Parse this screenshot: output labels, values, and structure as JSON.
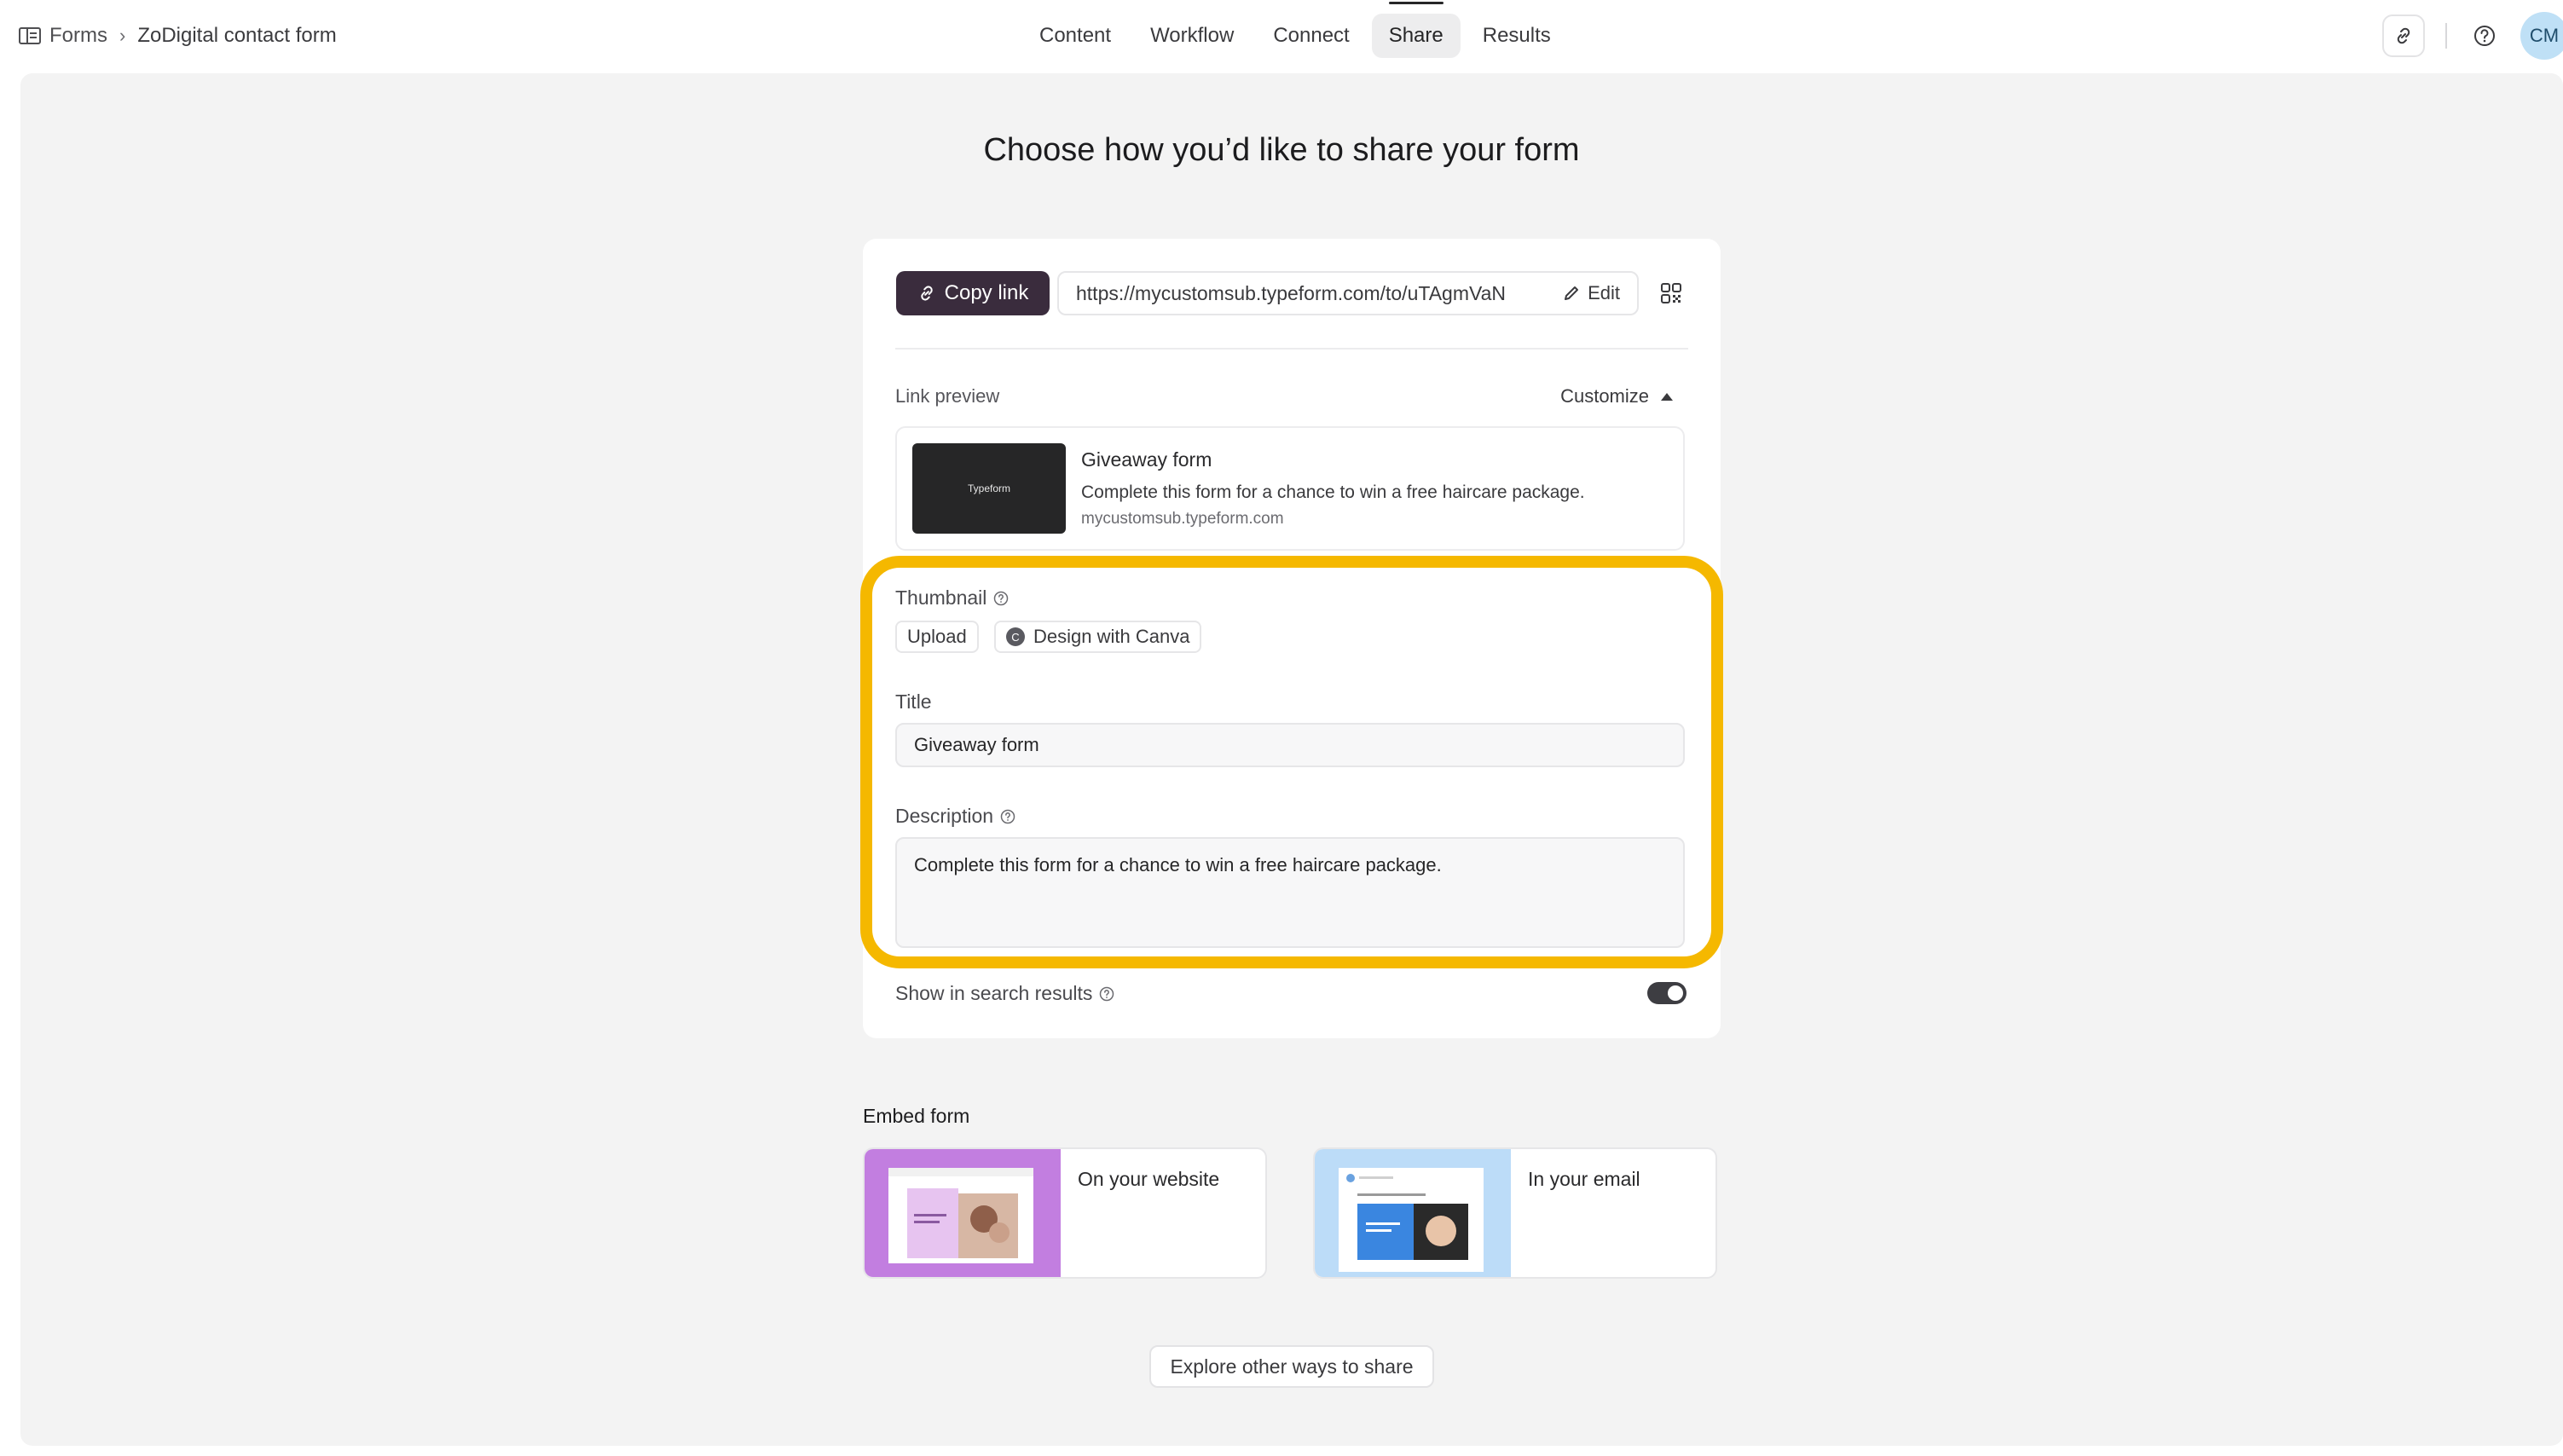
{
  "breadcrumb": {
    "root": "Forms",
    "current": "ZoDigital contact form"
  },
  "nav": {
    "tabs": [
      {
        "label": "Content"
      },
      {
        "label": "Workflow"
      },
      {
        "label": "Connect"
      },
      {
        "label": "Share",
        "active": true
      },
      {
        "label": "Results"
      }
    ]
  },
  "user": {
    "initials": "CM"
  },
  "page": {
    "heading": "Choose how you’d like to share your form"
  },
  "share": {
    "copy_label": "Copy link",
    "url": "https://mycustomsub.typeform.com/to/uTAgmVaN",
    "edit_label": "Edit",
    "link_preview_label": "Link preview",
    "customize_label": "Customize",
    "preview": {
      "thumb_text": "Typeform",
      "title": "Giveaway form",
      "description": "Complete this form for a chance to win a free haircare package.",
      "domain": "mycustomsub.typeform.com"
    },
    "thumbnail_label": "Thumbnail",
    "upload_label": "Upload",
    "canva_label": "Design with Canva",
    "title_label": "Title",
    "title_value": "Giveaway form",
    "description_label": "Description",
    "description_value": "Complete this form for a chance to win a free haircare package.",
    "search_label": "Show in search results",
    "search_enabled": true
  },
  "embed": {
    "heading": "Embed form",
    "website_label": "On your website",
    "email_label": "In your email"
  },
  "explore_label": "Explore other ways to share",
  "colors": {
    "accent": "#3a2c3d",
    "highlight": "#f5b800",
    "panel": "#f3f3f3"
  },
  "icons": [
    "forms-icon",
    "chevron-right-icon",
    "link-icon",
    "help-icon",
    "pencil-icon",
    "qr-code-icon",
    "info-icon",
    "caret-up-icon",
    "canva-icon"
  ]
}
